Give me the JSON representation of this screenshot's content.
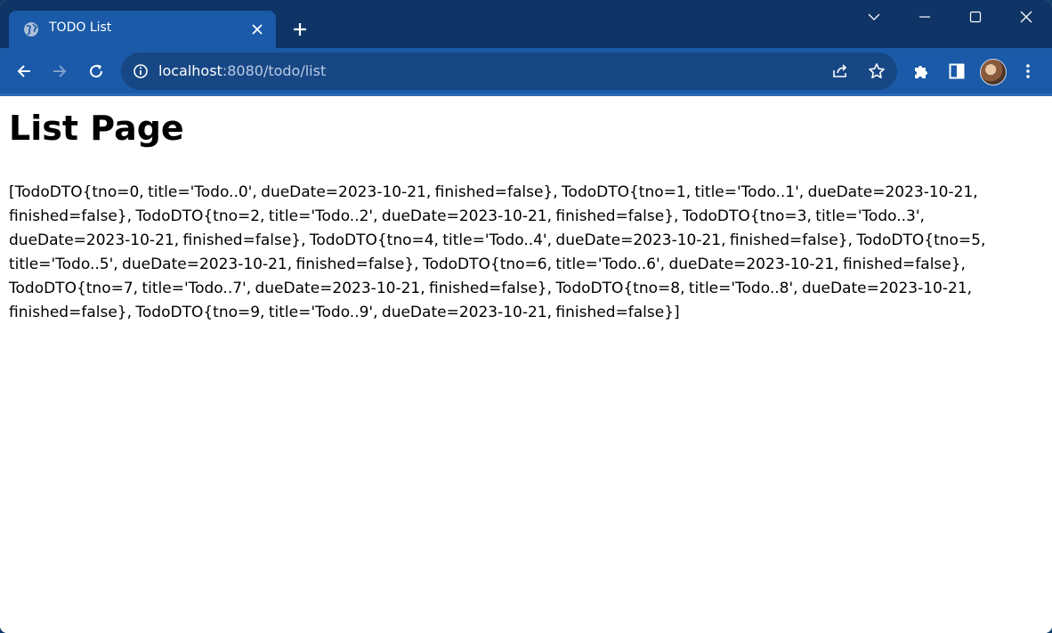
{
  "tab": {
    "title": "TODO List"
  },
  "address_bar": {
    "host": "localhost",
    "rest": ":8080/todo/list"
  },
  "page": {
    "heading": "List Page",
    "body": "[TodoDTO{tno=0, title='Todo..0', dueDate=2023-10-21, finished=false}, TodoDTO{tno=1, title='Todo..1', dueDate=2023-10-21, finished=false}, TodoDTO{tno=2, title='Todo..2', dueDate=2023-10-21, finished=false}, TodoDTO{tno=3, title='Todo..3', dueDate=2023-10-21, finished=false}, TodoDTO{tno=4, title='Todo..4', dueDate=2023-10-21, finished=false}, TodoDTO{tno=5, title='Todo..5', dueDate=2023-10-21, finished=false}, TodoDTO{tno=6, title='Todo..6', dueDate=2023-10-21, finished=false}, TodoDTO{tno=7, title='Todo..7', dueDate=2023-10-21, finished=false}, TodoDTO{tno=8, title='Todo..8', dueDate=2023-10-21, finished=false}, TodoDTO{tno=9, title='Todo..9', dueDate=2023-10-21, finished=false}]"
  },
  "icons": {
    "favicon": "globe-icon",
    "tab_close": "close-icon",
    "new_tab": "plus-icon",
    "tab_search": "chevron-down-icon",
    "minimize": "minimize-icon",
    "maximize": "maximize-icon",
    "close_window": "close-icon",
    "back": "arrow-left-icon",
    "forward": "arrow-right-icon",
    "reload": "reload-icon",
    "site_info": "info-icon",
    "share": "share-icon",
    "bookmark": "star-icon",
    "extensions": "puzzle-icon",
    "side_panel": "side-panel-icon",
    "profile": "avatar",
    "menu": "more-vertical-icon"
  },
  "colors": {
    "tabstrip": "#0e3566",
    "active_tab": "#1a5aa8",
    "toolbar": "#1a5aa8",
    "omnibox": "#174784",
    "page_background": "#ffffff",
    "text": "#000000"
  }
}
